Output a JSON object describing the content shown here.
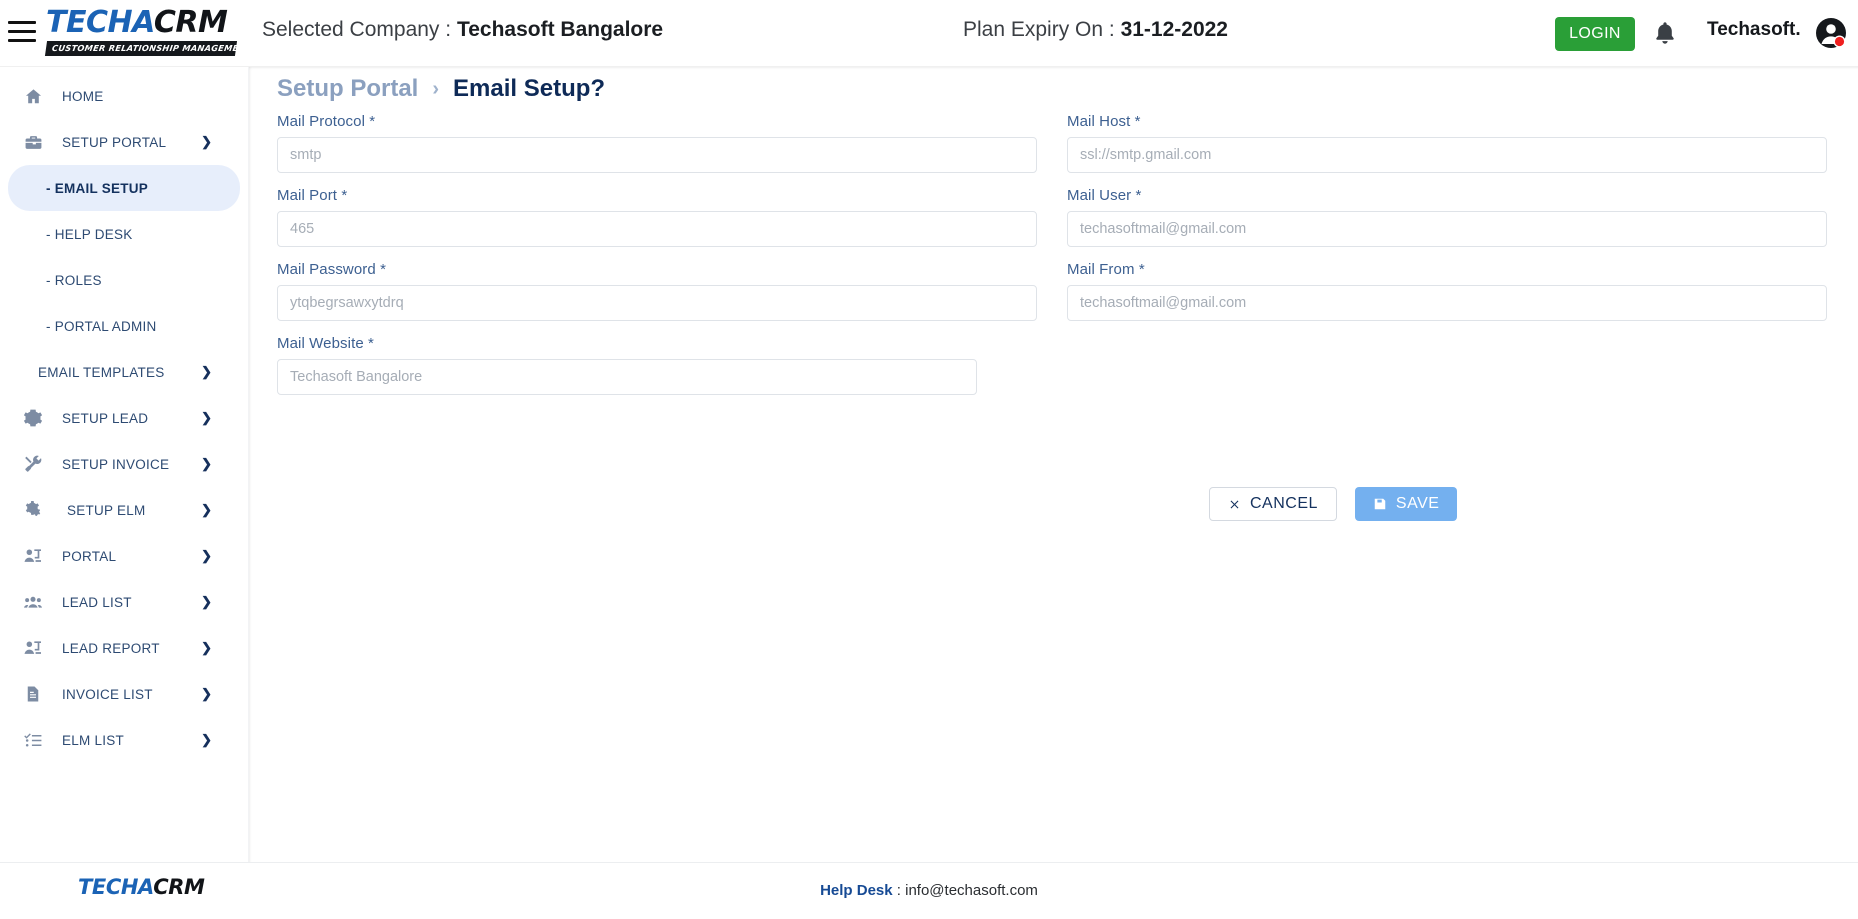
{
  "brand": {
    "logo_part_1": "TECHA",
    "logo_part_2": "CRM",
    "logo_tagline": "CUSTOMER RELATIONSHIP MANAGEMENT",
    "accent_blue": "#1b63b5",
    "accent_dark": "#111418"
  },
  "header": {
    "menu_icon": "hamburger-icon",
    "selected_company_label": "Selected Company : ",
    "selected_company_value": "Techasoft Bangalore",
    "plan_expiry_label": "Plan Expiry On : ",
    "plan_expiry_value": "31-12-2022",
    "login_label": "LOGIN",
    "login_color": "#2a9f37",
    "notification_icon": "bell-icon",
    "user_name": "Techasoft.",
    "avatar_icon": "user-avatar-icon",
    "avatar_badge_color": "#f01f1f"
  },
  "sidebar": {
    "items": [
      {
        "label": "HOME",
        "icon": "home-icon",
        "level": 0,
        "chevron": false,
        "active": false
      },
      {
        "label": "SETUP PORTAL",
        "icon": "toolbox-icon",
        "level": 0,
        "chevron": true,
        "active": false
      },
      {
        "label": "- EMAIL SETUP",
        "icon": "",
        "level": 1,
        "chevron": false,
        "active": true
      },
      {
        "label": "- HELP DESK",
        "icon": "",
        "level": 1,
        "chevron": false,
        "active": false
      },
      {
        "label": "- ROLES",
        "icon": "",
        "level": 1,
        "chevron": false,
        "active": false
      },
      {
        "label": "- PORTAL ADMIN",
        "icon": "",
        "level": 1,
        "chevron": false,
        "active": false
      },
      {
        "label": "EMAIL TEMPLATES",
        "icon": "",
        "level": 2,
        "chevron": true,
        "active": false
      },
      {
        "label": "SETUP LEAD",
        "icon": "gear-icon",
        "level": 0,
        "chevron": true,
        "active": false
      },
      {
        "label": "SETUP INVOICE",
        "icon": "tools-icon",
        "level": 0,
        "chevron": true,
        "active": false
      },
      {
        "label": "SETUP ELM",
        "icon": "gears-icon",
        "level": 0,
        "chevron": true,
        "active": false
      },
      {
        "label": "PORTAL",
        "icon": "presentation-user-icon",
        "level": 0,
        "chevron": true,
        "active": false
      },
      {
        "label": "LEAD LIST",
        "icon": "users-icon",
        "level": 0,
        "chevron": true,
        "active": false
      },
      {
        "label": "LEAD REPORT",
        "icon": "presentation-user-icon",
        "level": 0,
        "chevron": true,
        "active": false
      },
      {
        "label": "INVOICE LIST",
        "icon": "document-icon",
        "level": 0,
        "chevron": true,
        "active": false
      },
      {
        "label": "ELM LIST",
        "icon": "checklist-icon",
        "level": 0,
        "chevron": true,
        "active": false
      }
    ]
  },
  "breadcrumb": {
    "parent": "Setup Portal",
    "separator": "›",
    "current": "Email Setup?"
  },
  "form": {
    "left": [
      {
        "label": "Mail Protocol *",
        "value": "smtp",
        "placeholder": "smtp",
        "name": "mail-protocol-input"
      },
      {
        "label": "Mail Port *",
        "value": "465",
        "placeholder": "465",
        "name": "mail-port-input"
      },
      {
        "label": "Mail Password *",
        "value": "ytqbegrsawxytdrq",
        "placeholder": "ytqbegrsawxytdrq",
        "name": "mail-password-input"
      },
      {
        "label": "Mail Website *",
        "value": "Techasoft Bangalore",
        "placeholder": "Techasoft Bangalore",
        "name": "mail-website-input"
      }
    ],
    "right": [
      {
        "label": "Mail Host *",
        "value": "",
        "placeholder": "ssl://smtp.gmail.com",
        "name": "mail-host-input"
      },
      {
        "label": "Mail User *",
        "value": "",
        "placeholder": "techasoftmail@gmail.com",
        "name": "mail-user-input"
      },
      {
        "label": "Mail From *",
        "value": "",
        "placeholder": "techasoftmail@gmail.com",
        "name": "mail-from-input"
      }
    ],
    "cancel_label": "CANCEL",
    "cancel_icon": "close-x-icon",
    "save_label": "SAVE",
    "save_icon": "floppy-disk-save-icon",
    "save_color": "#74b0ef"
  },
  "footer": {
    "logo_part_1": "TECHA",
    "logo_part_2": "CRM",
    "help_label": "Help Desk",
    "help_separator": " : ",
    "help_email": "info@techasoft.com"
  }
}
